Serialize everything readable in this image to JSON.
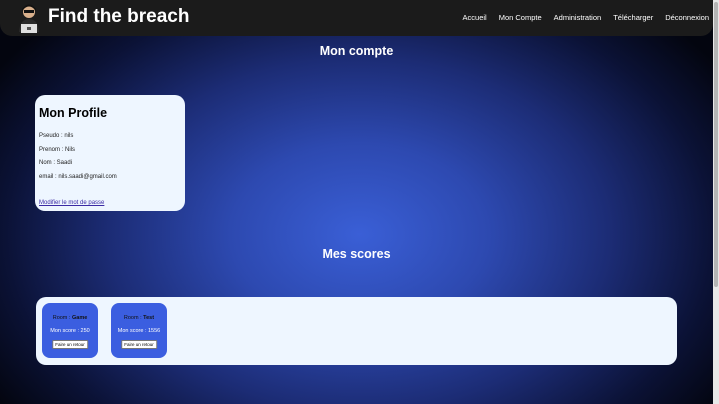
{
  "app": {
    "brand": "Find the breach"
  },
  "nav": {
    "items": [
      "Accueil",
      "Mon Compte",
      "Administration",
      "Télécharger",
      "Déconnexion"
    ]
  },
  "account": {
    "section_title": "Mon compte",
    "profile": {
      "title": "Mon Profile",
      "fields": [
        "Pseudo : nils",
        "Prenom : Nils",
        "Nom : Saadi",
        "email : nils.saadi@gmail.com"
      ],
      "change_password_label": "Modifier le mot de passe"
    }
  },
  "scores": {
    "section_title": "Mes scores",
    "room_prefix": "Room : ",
    "score_prefix": "Mon score : ",
    "button_label": "Faire un retour",
    "items": [
      {
        "room": "Game",
        "score": "250"
      },
      {
        "room": "Test",
        "score": "1556"
      }
    ]
  },
  "colors": {
    "accent": "#3b5ee0",
    "card_bg": "#eef6ff",
    "navbar": "#1b1b1b"
  }
}
